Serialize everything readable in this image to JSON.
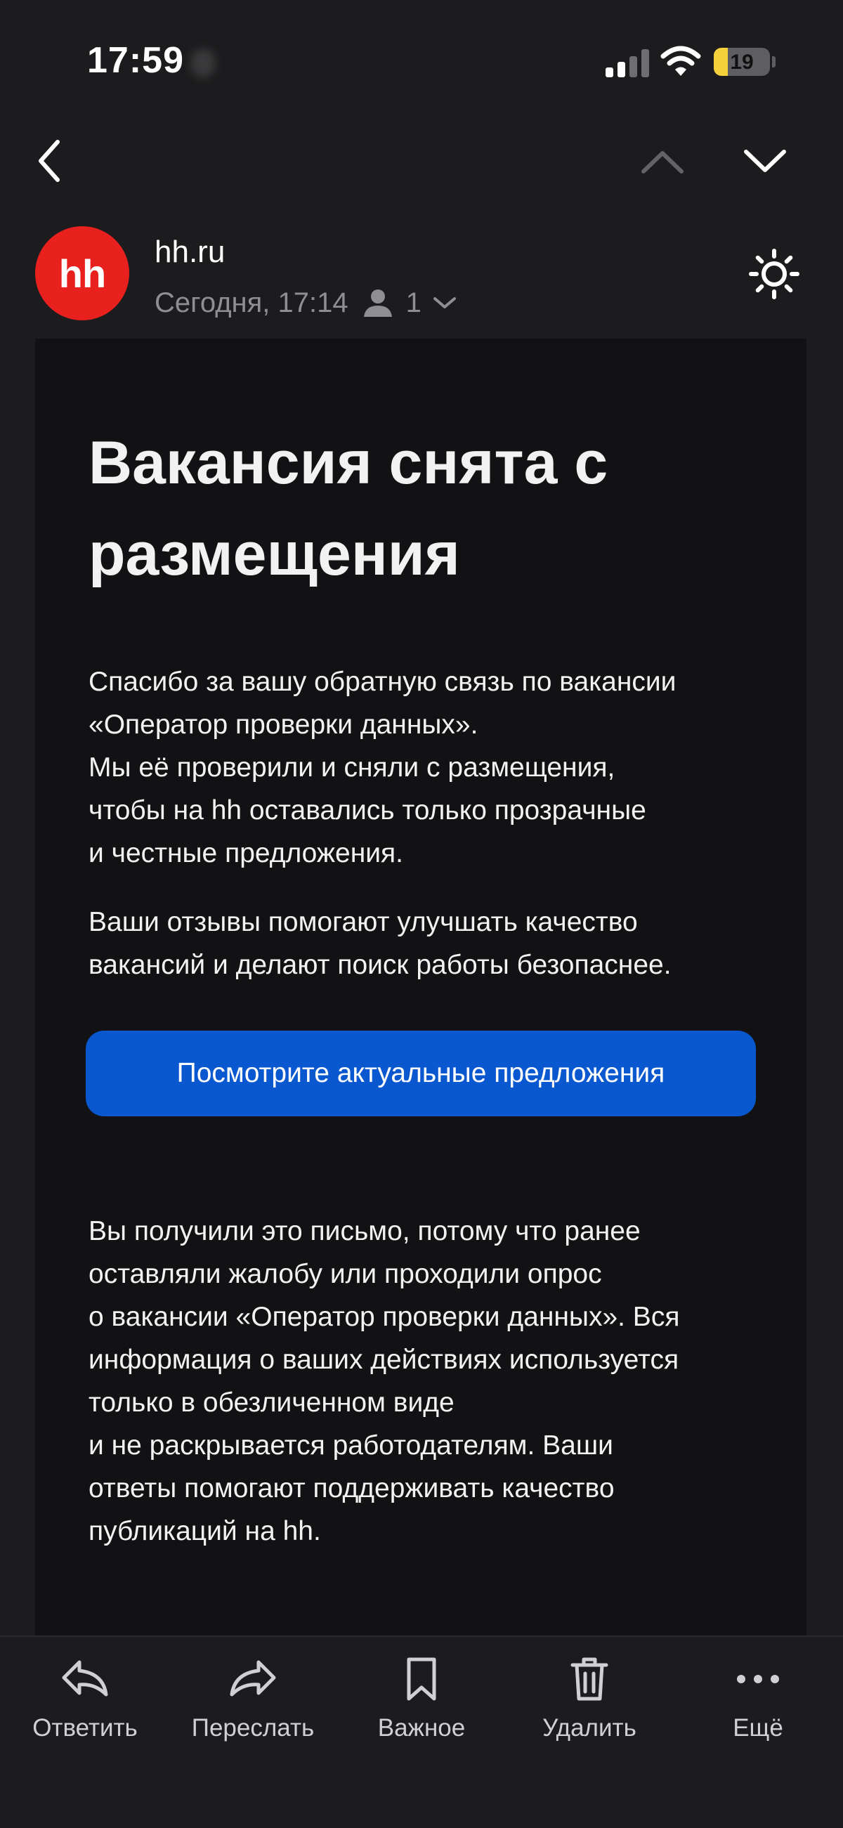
{
  "status_bar": {
    "time": "17:59",
    "battery": "19",
    "battery_level": 0.19
  },
  "nav": {
    "back_icon": "chevron-left-icon",
    "prev_icon": "chevron-up-icon",
    "next_icon": "chevron-down-icon",
    "prev_enabled": false
  },
  "message": {
    "avatar_text": "hh",
    "avatar_color": "#e8201e",
    "sender": "hh.ru",
    "date": "Сегодня, 17:14",
    "recipients_count": "1"
  },
  "email": {
    "headline": "Вакансия снята с размещения",
    "paragraph1": "Спасибо за вашу обратную связь по вакансии\n«Оператор проверки данных».\nМы её проверили и сняли с размещения,\nчтобы на hh оставались только прозрачные\nи честные предложения.",
    "paragraph2": "Ваши отзывы помогают улучшать качество\nвакансий и делают поиск работы безопаснее.",
    "cta_label": "Посмотрите актуальные предложения",
    "cta_color": "#0a58d0",
    "footer_note": "Вы получили это письмо, потому что ранее\nоставляли жалобу или проходили опрос\nо вакансии «Оператор проверки данных». Вся\nинформация о ваших действиях используется\nтолько в обезличенном виде\nи не раскрывается работодателям. Ваши\nответы помогают поддерживать качество\nпубликаций на hh."
  },
  "toolbar": {
    "reply": "Ответить",
    "forward": "Переслать",
    "important": "Важное",
    "delete": "Удалить",
    "more": "Ещё"
  }
}
